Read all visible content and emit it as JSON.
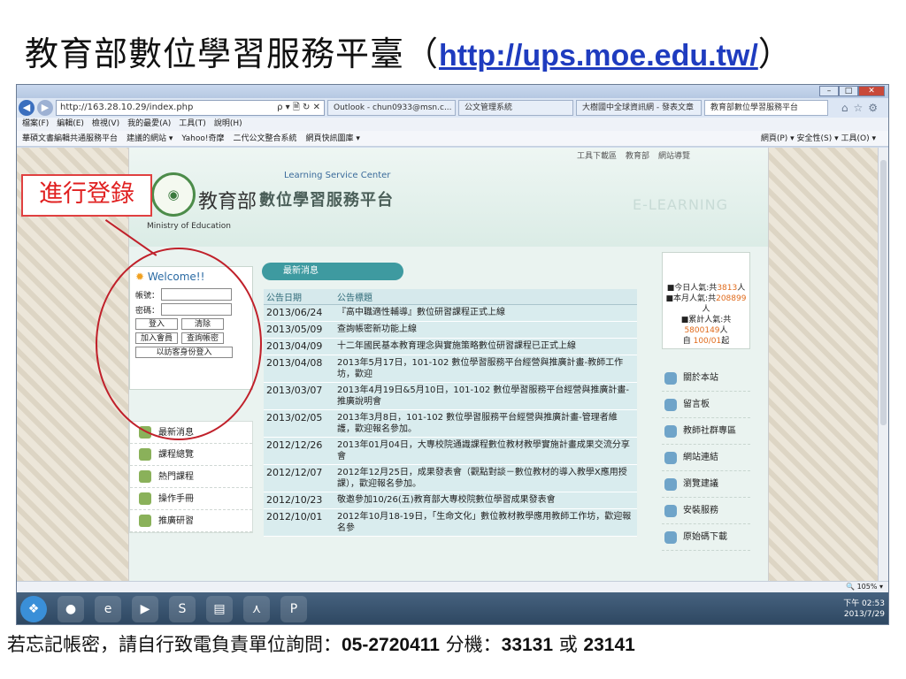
{
  "slide": {
    "title": "教育部數位學習服務平臺（",
    "title_url": "http://ups.moe.edu.tw/",
    "title_end": "）",
    "footer_text": "若忘記帳密，請自行致電負責單位詢問：",
    "footer_phone": "05-2720411",
    "footer_ext_label": " 分機：",
    "footer_ext": "33131",
    "footer_or": " 或 ",
    "footer_ext2": "23141",
    "annotation": "進行登錄"
  },
  "browser": {
    "address": "http://163.28.10.29/index.php",
    "address_icons": "ρ ▾ 🗎 ↻ ✕",
    "tabs": [
      "Outlook - chun0933@msn.c...",
      "公文管理系統",
      "大樹國中全球資訊網 - 發表文章",
      "教育部數位學習服務平台"
    ],
    "menu": [
      "檔案(F)",
      "編輯(E)",
      "檢視(V)",
      "我的最愛(A)",
      "工具(T)",
      "說明(H)"
    ],
    "favorites": [
      "華碩文書編輯共通服務平台",
      "建議的網站 ▾",
      "Yahoo!奇摩",
      "二代公文整合系統",
      "網頁快訊圖庫 ▾"
    ],
    "fav_right": "網頁(P) ▾  安全性(S) ▾  工具(O) ▾",
    "zoom": "105%"
  },
  "site": {
    "top_links": [
      "工具下載區",
      "教育部",
      "網站導覽"
    ],
    "logo_zh": "教育部",
    "logo_en": "Ministry of Education",
    "center_en": "Learning Service Center",
    "system_name": "數位學習服務平台",
    "elearning": "E-LEARNING",
    "login": {
      "welcome": "Welcome!!",
      "account_label": "帳號：",
      "password_label": "密碼：",
      "login_btn": "登入",
      "clear_btn": "清除",
      "join_btn": "加入會員",
      "lookup_btn": "查詢帳密",
      "guest_btn": "以訪客身份登入"
    },
    "left_nav": [
      "最新消息",
      "課程總覽",
      "熱門課程",
      "操作手冊",
      "推廣研習"
    ],
    "news_header": "最新消息",
    "news_cols": [
      "公告日期",
      "公告標題"
    ],
    "news": [
      {
        "date": "2013/06/24",
        "title": "『高中職適性輔導』數位研習課程正式上線"
      },
      {
        "date": "2013/05/09",
        "title": "查詢帳密新功能上線"
      },
      {
        "date": "2013/04/09",
        "title": "十二年國民基本教育理念與實施策略數位研習課程已正式上線"
      },
      {
        "date": "2013/04/08",
        "title": "2013年5月17日，101-102 數位學習服務平台經營與推廣計畫-教師工作坊，歡迎"
      },
      {
        "date": "2013/03/07",
        "title": "2013年4月19日&5月10日，101-102 數位學習服務平台經營與推廣計畫-推廣說明會"
      },
      {
        "date": "2013/02/05",
        "title": "2013年3月8日，101-102 數位學習服務平台經營與推廣計畫-管理者維護，歡迎報名參加。"
      },
      {
        "date": "2012/12/26",
        "title": "2013年01月04日，大專校院通識課程數位教材教學實施計畫成果交流分享會"
      },
      {
        "date": "2012/12/07",
        "title": "2012年12月25日，成果發表會（觀點對談－數位教材的導入教學X應用授課），歡迎報名參加。"
      },
      {
        "date": "2012/10/23",
        "title": "敬邀參加10/26(五)教育部大專校院數位學習成果發表會"
      },
      {
        "date": "2012/10/01",
        "title": "2012年10月18-19日，「生命文化」數位教材教學應用教師工作坊，歡迎報名參"
      }
    ],
    "stats": {
      "today_label": "今日人氣:共",
      "today": "3813",
      "month_label": "本月人氣:共",
      "month": "208899",
      "total_label": "累計人氣:共",
      "total": "5800149",
      "since": "100/01",
      "unit": "人",
      "since_label": "自",
      "since_suffix": "起"
    },
    "right_nav": [
      "關於本站",
      "留言板",
      "教師社群專區",
      "網站連結",
      "瀏覽建議",
      "安裝服務",
      "原始碼下載"
    ]
  },
  "taskbar": {
    "time": "下午 02:53",
    "date": "2013/7/29"
  }
}
